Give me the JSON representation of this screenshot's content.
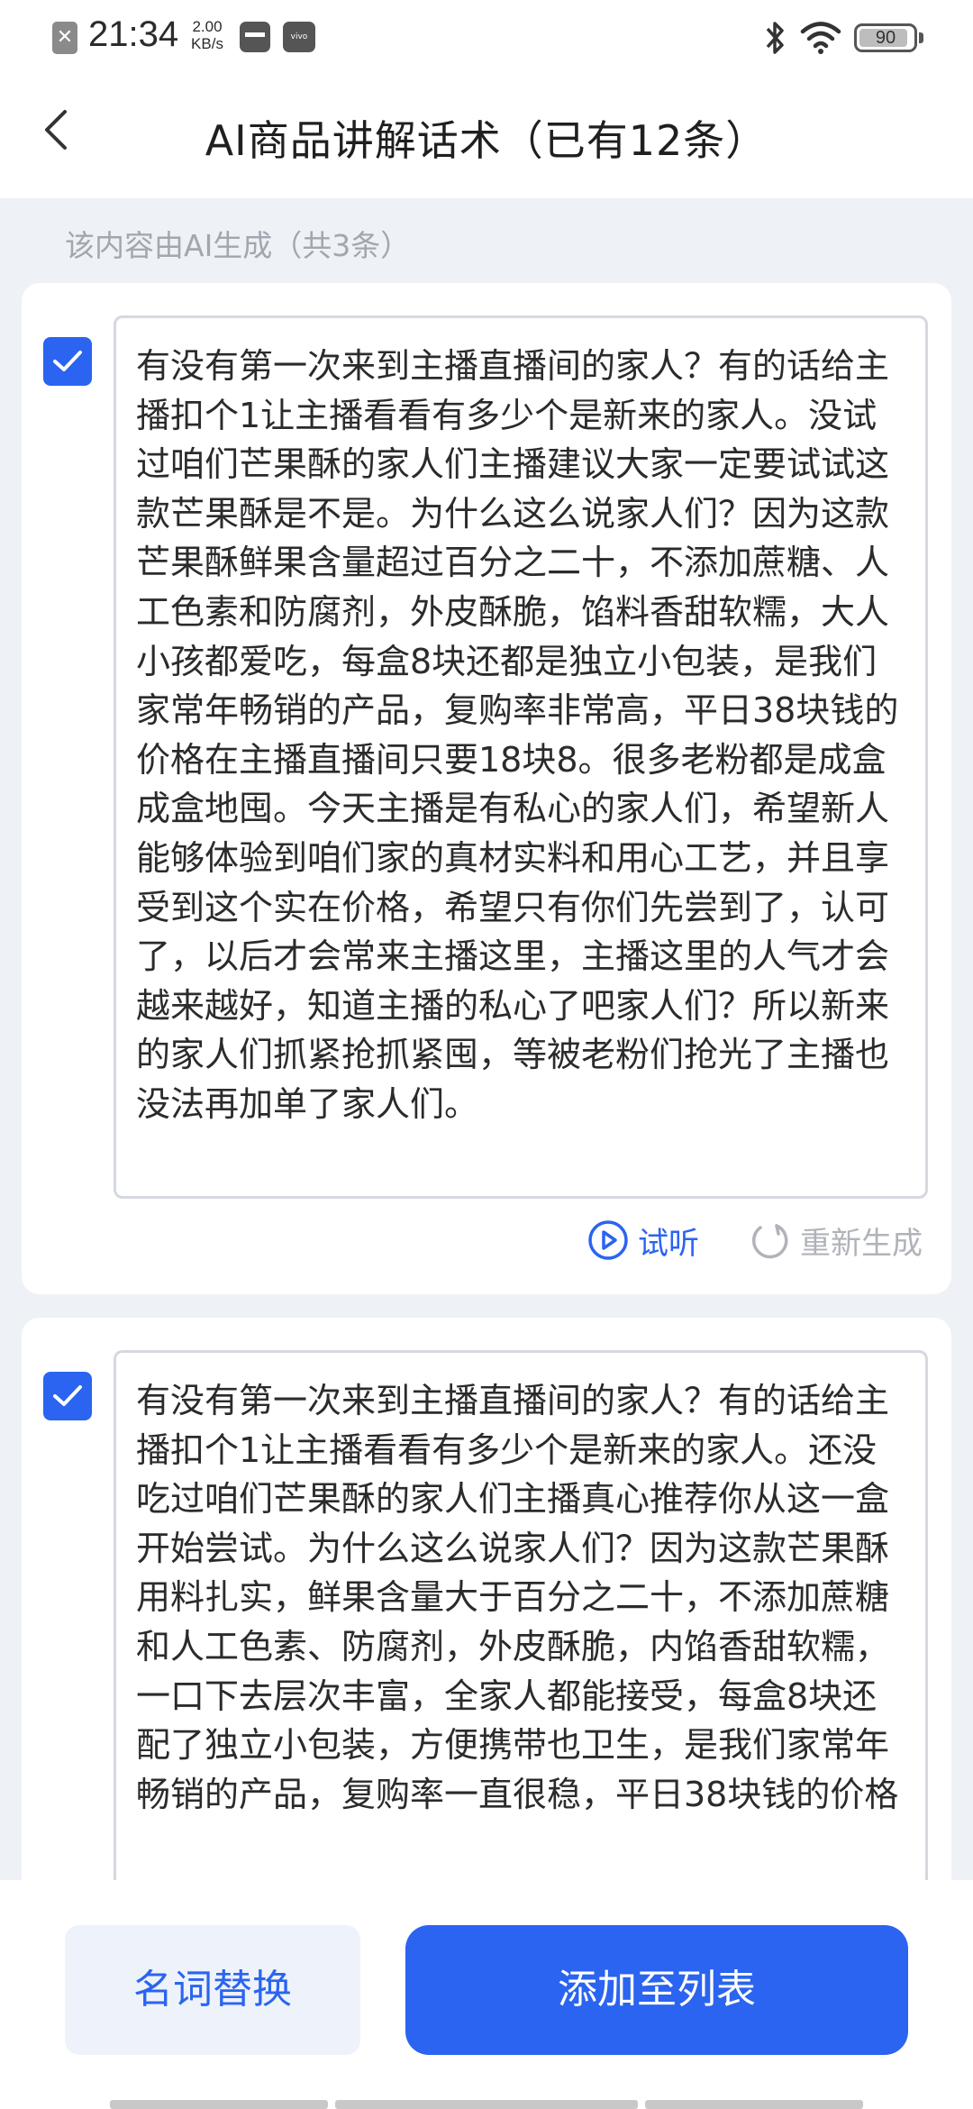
{
  "status_bar": {
    "time": "21:34",
    "network_speed_value": "2.00",
    "network_speed_unit": "KB/s",
    "battery_level": 90,
    "battery_text": "90",
    "icons": [
      "notification-x-icon",
      "card-icon",
      "vivo-icon",
      "bluetooth-icon",
      "wifi-icon",
      "battery-icon"
    ]
  },
  "header": {
    "title": "AI商品讲解话术（已有12条）",
    "back_icon": "chevron-left-icon"
  },
  "ai_note": "该内容由AI生成（共3条）",
  "scripts": [
    {
      "checked": true,
      "text": "有没有第一次来到主播直播间的家人？有的话给主播扣个1让主播看看有多少个是新来的家人。没试过咱们芒果酥的家人们主播建议大家一定要试试这款芒果酥是不是。为什么这么说家人们？因为这款芒果酥鲜果含量超过百分之二十，不添加蔗糖、人工色素和防腐剂，外皮酥脆，馅料香甜软糯，大人小孩都爱吃，每盒8块还都是独立小包装，是我们家常年畅销的产品，复购率非常高，平日38块钱的价格在主播直播间只要18块8。很多老粉都是成盒成盒地囤。今天主播是有私心的家人们，希望新人能够体验到咱们家的真材实料和用心工艺，并且享受到这个实在价格，希望只有你们先尝到了，认可了，以后才会常来主播这里，主播这里的人气才会越来越好，知道主播的私心了吧家人们？所以新来的家人们抓紧抢抓紧囤，等被老粉们抢光了主播也没法再加单了家人们。",
      "preview_label": "试听",
      "regenerate_label": "重新生成"
    },
    {
      "checked": true,
      "text": "有没有第一次来到主播直播间的家人？有的话给主播扣个1让主播看看有多少个是新来的家人。还没吃过咱们芒果酥的家人们主播真心推荐你从这一盒开始尝试。为什么这么说家人们？因为这款芒果酥用料扎实，鲜果含量大于百分之二十，不添加蔗糖和人工色素、防腐剂，外皮酥脆，内馅香甜软糯，一口下去层次丰富，全家人都能接受，每盒8块还配了独立小包装，方便携带也卫生，是我们家常年畅销的产品，复购率一直很稳，平日38块钱的价格"
    }
  ],
  "bottom_bar": {
    "replace_label": "名词替换",
    "add_label": "添加至列表"
  },
  "colors": {
    "accent": "#2a64f0",
    "background": "#eef1f6",
    "muted_text": "#a2a6ae"
  }
}
